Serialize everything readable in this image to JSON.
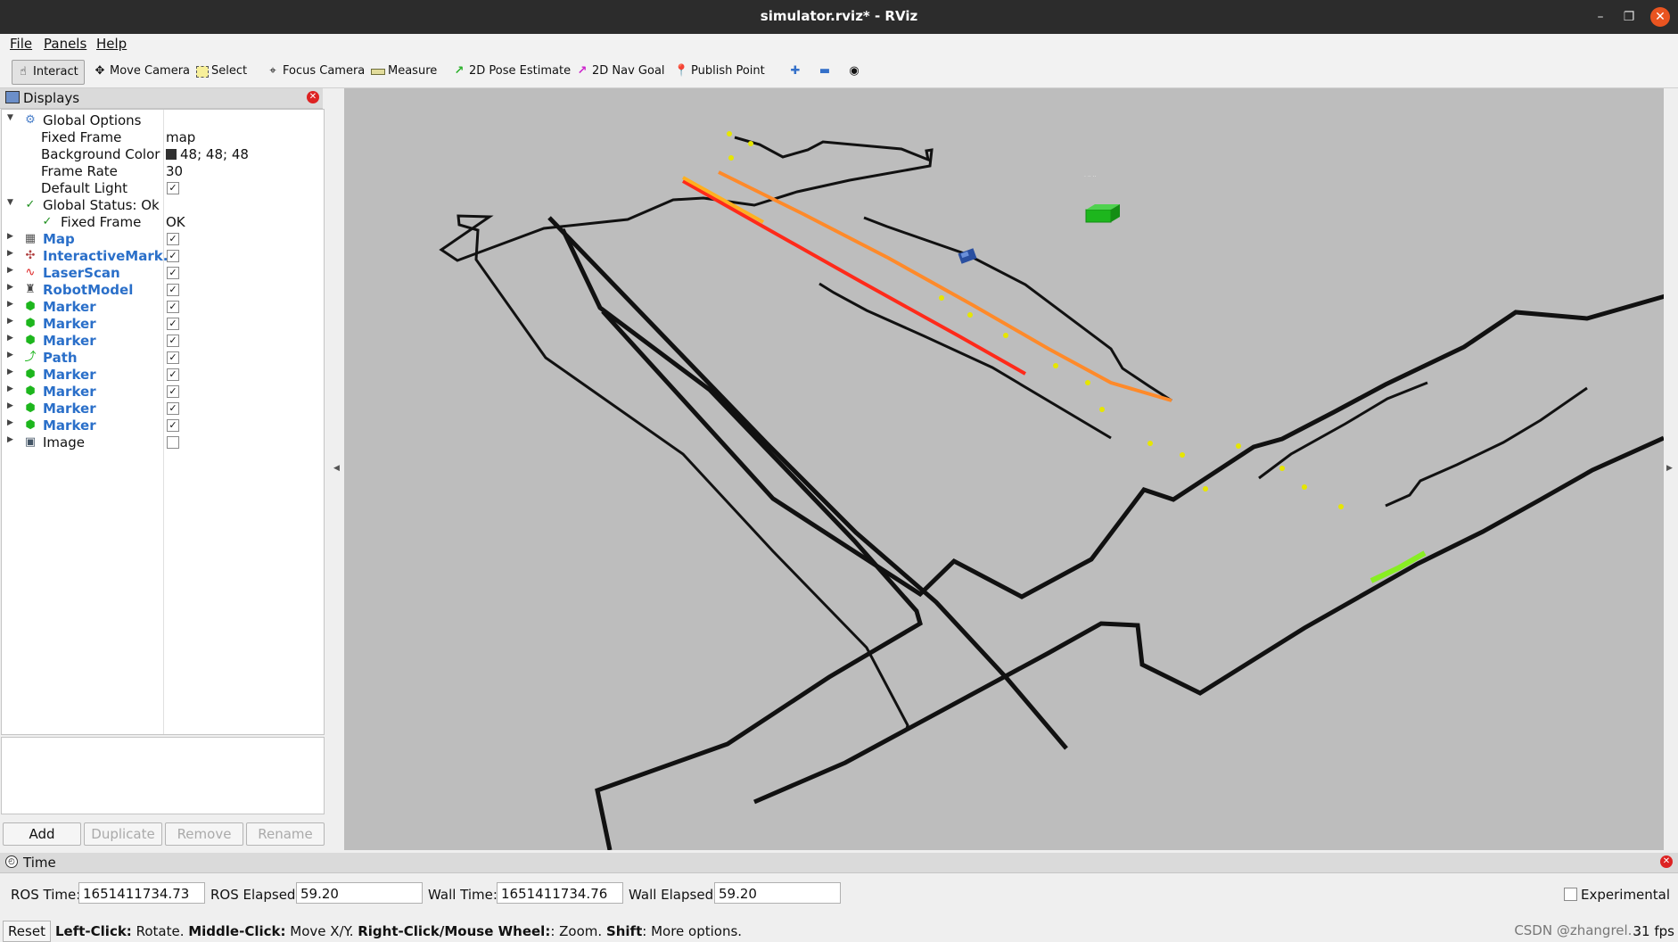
{
  "window": {
    "title": "simulator.rviz* - RViz"
  },
  "menu": [
    "File",
    "Panels",
    "Help"
  ],
  "toolbar": {
    "tools": [
      {
        "label": "Interact",
        "icon": "hand-pointer-icon"
      },
      {
        "label": "Move Camera",
        "icon": "move-camera-icon"
      },
      {
        "label": "Select",
        "icon": "select-box-icon"
      },
      {
        "label": "Focus Camera",
        "icon": "focus-crosshair-icon"
      },
      {
        "label": "Measure",
        "icon": "ruler-icon"
      },
      {
        "label": "2D Pose Estimate",
        "icon": "pose-arrow-icon"
      },
      {
        "label": "2D Nav Goal",
        "icon": "nav-goal-arrow-icon"
      },
      {
        "label": "Publish Point",
        "icon": "map-pin-icon"
      }
    ]
  },
  "displays": {
    "title": "Displays",
    "global_options": {
      "label": "Global Options",
      "fixed_frame": {
        "name": "Fixed Frame",
        "value": "map"
      },
      "background_color": {
        "name": "Background Color",
        "value": "48; 48; 48",
        "color": "#303030"
      },
      "frame_rate": {
        "name": "Frame Rate",
        "value": "30"
      },
      "default_light": {
        "name": "Default Light",
        "checked": true
      }
    },
    "global_status": {
      "label": "Global Status: Ok",
      "fixed_frame": {
        "name": "Fixed Frame",
        "value": "OK"
      }
    },
    "items": [
      {
        "name": "Map",
        "checked": true,
        "icon": "map-grid-icon"
      },
      {
        "name": "InteractiveMark...",
        "checked": true,
        "icon": "interactive-marker-icon"
      },
      {
        "name": "LaserScan",
        "checked": true,
        "icon": "laser-scan-icon"
      },
      {
        "name": "RobotModel",
        "checked": true,
        "icon": "robot-model-icon"
      },
      {
        "name": "Marker",
        "checked": true,
        "icon": "marker-cube-icon"
      },
      {
        "name": "Marker",
        "checked": true,
        "icon": "marker-cube-icon"
      },
      {
        "name": "Marker",
        "checked": true,
        "icon": "marker-cube-icon"
      },
      {
        "name": "Path",
        "checked": true,
        "icon": "path-line-icon"
      },
      {
        "name": "Marker",
        "checked": true,
        "icon": "marker-cube-icon"
      },
      {
        "name": "Marker",
        "checked": true,
        "icon": "marker-cube-icon"
      },
      {
        "name": "Marker",
        "checked": true,
        "icon": "marker-cube-icon"
      },
      {
        "name": "Marker",
        "checked": true,
        "icon": "marker-cube-icon"
      },
      {
        "name": "Image",
        "checked": false,
        "icon": "image-icon"
      }
    ],
    "buttons": {
      "add": "Add",
      "duplicate": "Duplicate",
      "remove": "Remove",
      "rename": "Rename"
    }
  },
  "time": {
    "title": "Time",
    "ros_time_label": "ROS Time:",
    "ros_time": "1651411734.73",
    "ros_elapsed_label": "ROS Elapsed:",
    "ros_elapsed": "59.20",
    "wall_time_label": "Wall Time:",
    "wall_time": "1651411734.76",
    "wall_elapsed_label": "Wall Elapsed:",
    "wall_elapsed": "59.20",
    "experimental_label": "Experimental",
    "experimental_checked": false
  },
  "status": {
    "reset": "Reset",
    "left_click": "Left-Click:",
    "left_click_desc": " Rotate. ",
    "middle_click": "Middle-Click:",
    "middle_click_desc": " Move X/Y. ",
    "right_click": "Right-Click/Mouse Wheel:",
    "right_click_desc": ": Zoom. ",
    "shift": "Shift",
    "shift_desc": ": More options.",
    "fps": "31 fps",
    "watermark": "CSDN @zhangrel..."
  },
  "viewport": {
    "background": "#bdbdbd",
    "wall_color": "#111111",
    "path_color": "#ff2a1a",
    "marker_color": "#1db61d",
    "point_color": "#e6e600"
  }
}
